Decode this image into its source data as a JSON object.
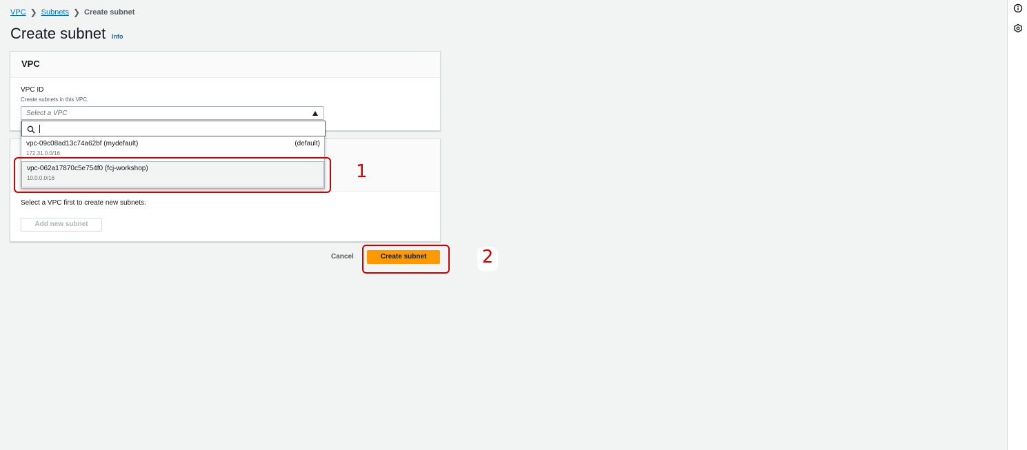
{
  "breadcrumb": {
    "items": [
      "VPC",
      "Subnets"
    ],
    "current": "Create subnet"
  },
  "page": {
    "title": "Create subnet",
    "info_label": "Info"
  },
  "vpc_panel": {
    "title": "VPC",
    "field_label": "VPC ID",
    "field_description": "Create subnets in this VPC.",
    "select_placeholder": "Select a VPC",
    "search_value": "",
    "options": [
      {
        "id": "vpc-09c08ad13c74a62bf (mydefault)",
        "cidr": "172.31.0.0/16",
        "tag": "(default)"
      },
      {
        "id": "vpc-062a17870c5e754f0 (fcj-workshop)",
        "cidr": "10.0.0.0/16",
        "tag": ""
      }
    ]
  },
  "subnet_panel": {
    "empty_text": "Select a VPC first to create new subnets.",
    "add_button": "Add new subnet"
  },
  "actions": {
    "cancel": "Cancel",
    "create": "Create subnet"
  },
  "annotations": {
    "step1": "1",
    "step2": "2"
  },
  "icons": {
    "rail_top": "info-circle-icon",
    "rail_second": "hexagon-settings-icon",
    "search": "search-icon",
    "caret": "caret-up-icon"
  },
  "colors": {
    "primary": "#ff9900",
    "link": "#0073bb",
    "annotation": "#d00000"
  }
}
